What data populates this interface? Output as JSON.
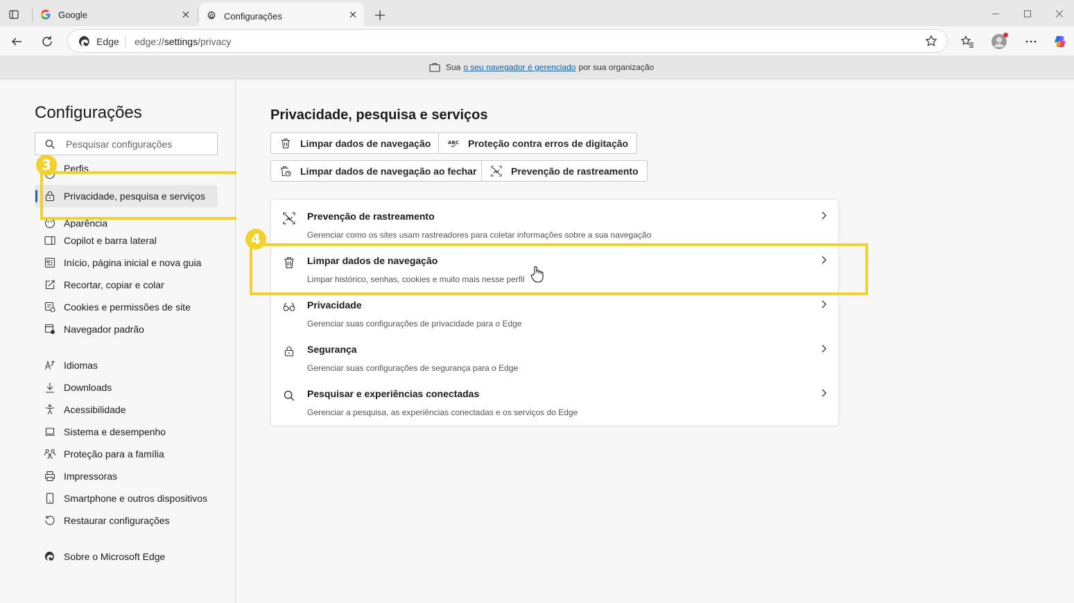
{
  "tabs": [
    {
      "title": "Google",
      "icon": "google-icon"
    },
    {
      "title": "Configurações",
      "icon": "gear-icon"
    }
  ],
  "toolbar": {
    "omnibox_label": "Edge",
    "url_prefix": "edge://",
    "url_main": "settings",
    "url_suffix": "/privacy"
  },
  "infobar": {
    "prefix": "Sua",
    "link": "o seu navegador é gerenciado",
    "suffix": "por sua organização"
  },
  "sidebar": {
    "title": "Configurações",
    "search_placeholder": "Pesquisar configurações",
    "items": [
      {
        "label": "Perfis",
        "icon": "profile-icon"
      },
      {
        "label": "Privacidade, pesquisa e serviços",
        "icon": "lock-icon",
        "active": true
      },
      {
        "label": "Aparência",
        "icon": "appearance-icon"
      },
      {
        "label": "Copilot e barra lateral",
        "icon": "sidebar-icon"
      },
      {
        "label": "Início, página inicial e nova guia",
        "icon": "home-icon"
      },
      {
        "label": "Recortar, copiar e colar",
        "icon": "share-icon"
      },
      {
        "label": "Cookies e permissões de site",
        "icon": "cookies-icon"
      },
      {
        "label": "Navegador padrão",
        "icon": "browser-icon"
      },
      {
        "label": "Idiomas",
        "icon": "language-icon"
      },
      {
        "label": "Downloads",
        "icon": "download-icon"
      },
      {
        "label": "Acessibilidade",
        "icon": "accessibility-icon"
      },
      {
        "label": "Sistema e desempenho",
        "icon": "laptop-icon"
      },
      {
        "label": "Proteção para a família",
        "icon": "family-icon"
      },
      {
        "label": "Impressoras",
        "icon": "printer-icon"
      },
      {
        "label": "Smartphone e outros dispositivos",
        "icon": "phone-icon"
      },
      {
        "label": "Restaurar configurações",
        "icon": "reset-icon"
      },
      {
        "label": "Sobre o Microsoft Edge",
        "icon": "edge-icon"
      }
    ]
  },
  "main": {
    "title": "Privacidade, pesquisa e serviços",
    "quick_buttons": [
      {
        "label": "Limpar dados de navegação",
        "icon": "trash-icon"
      },
      {
        "label": "Proteção contra erros de digitação",
        "icon": "spellcheck-icon"
      },
      {
        "label": "Limpar dados de navegação ao fechar",
        "icon": "trash-clock-icon"
      },
      {
        "label": "Prevenção de rastreamento",
        "icon": "tracking-icon"
      }
    ],
    "rows": [
      {
        "title": "Prevenção de rastreamento",
        "desc": "Gerenciar como os sites usam rastreadores para coletar informações sobre a sua navegação",
        "icon": "tracking-icon"
      },
      {
        "title": "Limpar dados de navegação",
        "desc": "Limpar histórico, senhas, cookies e muito mais nesse perfil",
        "icon": "trash-icon"
      },
      {
        "title": "Privacidade",
        "desc": "Gerenciar suas configurações de privacidade para o Edge",
        "icon": "glasses-icon"
      },
      {
        "title": "Segurança",
        "desc": "Gerenciar suas configurações de segurança para o Edge",
        "icon": "lock-icon"
      },
      {
        "title": "Pesquisar e experiências conectadas",
        "desc": "Gerenciar a pesquisa, as experiências conectadas e os serviços do Edge",
        "icon": "search-icon"
      }
    ]
  },
  "annotations": {
    "step3": "3",
    "step4": "4",
    "highlight_color": "#f2d22a"
  }
}
